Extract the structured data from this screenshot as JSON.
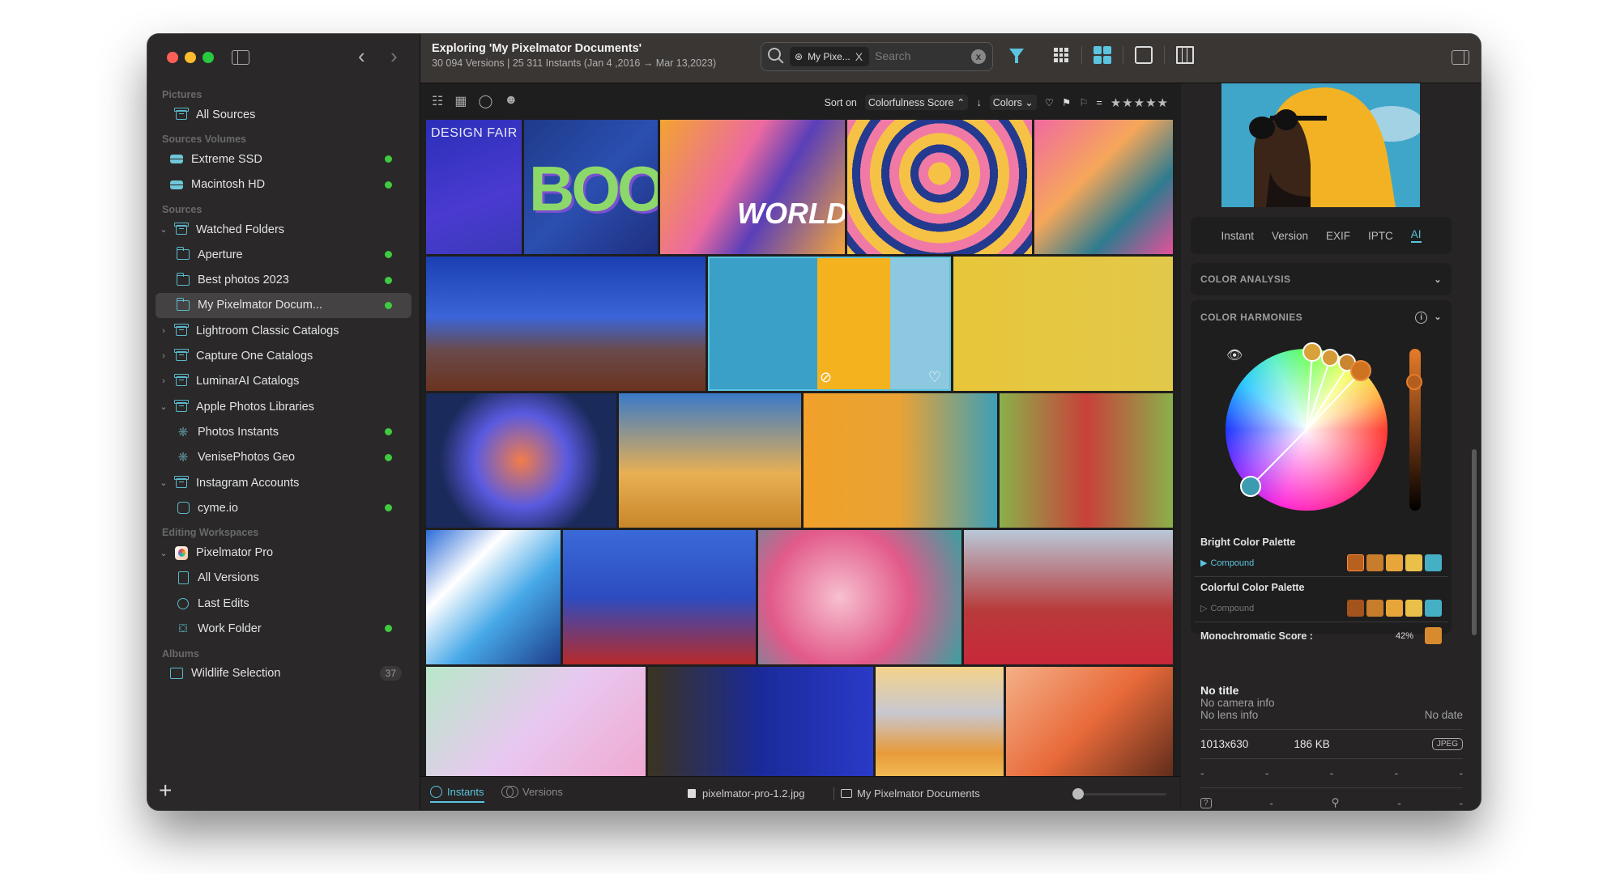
{
  "window": {
    "traffic_lights": [
      "close",
      "minimize",
      "zoom"
    ]
  },
  "sidebar": {
    "sections": [
      {
        "title": "Pictures",
        "items": [
          {
            "label": "All Sources",
            "icon": "archive-box-icon",
            "level": 0,
            "chevron": ""
          }
        ]
      },
      {
        "title": "Sources Volumes",
        "items": [
          {
            "label": "Extreme SSD",
            "icon": "drive-icon",
            "level": 1,
            "status": "online"
          },
          {
            "label": "Macintosh HD",
            "icon": "drive-icon",
            "level": 1,
            "status": "online"
          }
        ]
      },
      {
        "title": "Sources",
        "items": [
          {
            "label": "Watched Folders",
            "icon": "archive-box-icon",
            "level": 0,
            "chevron": "⌄"
          },
          {
            "label": "Aperture",
            "icon": "folder-icon",
            "level": 2,
            "status": "online"
          },
          {
            "label": "Best photos 2023",
            "icon": "folder-icon",
            "level": 2,
            "status": "online"
          },
          {
            "label": "My Pixelmator Docum...",
            "icon": "folder-icon",
            "level": 2,
            "status": "online",
            "selected": true
          },
          {
            "label": "Lightroom Classic Catalogs",
            "icon": "archive-box-icon",
            "level": 0,
            "chevron": "›"
          },
          {
            "label": "Capture One Catalogs",
            "icon": "archive-box-icon",
            "level": 0,
            "chevron": "›"
          },
          {
            "label": "LuminarAI Catalogs",
            "icon": "archive-box-icon",
            "level": 0,
            "chevron": "›"
          },
          {
            "label": "Apple Photos Libraries",
            "icon": "archive-box-icon",
            "level": 0,
            "chevron": "⌄"
          },
          {
            "label": "Photos Instants",
            "icon": "photos-flower-icon",
            "level": 2,
            "status": "online"
          },
          {
            "label": "VenisePhotos Geo",
            "icon": "photos-flower-icon",
            "level": 2,
            "status": "online"
          },
          {
            "label": "Instagram Accounts",
            "icon": "archive-box-icon",
            "level": 0,
            "chevron": "⌄"
          },
          {
            "label": "cyme.io",
            "icon": "instagram-icon",
            "level": 2,
            "status": "online"
          }
        ]
      },
      {
        "title": "Editing Workspaces",
        "items": [
          {
            "label": "Pixelmator Pro",
            "icon": "pixelmator-app-icon",
            "level": 0,
            "chevron": "⌄"
          },
          {
            "label": "All Versions",
            "icon": "document-icon",
            "level": 2
          },
          {
            "label": "Last Edits",
            "icon": "clock-icon",
            "level": 2
          },
          {
            "label": "Work Folder",
            "icon": "inbox-tray-icon",
            "level": 2,
            "status": "online"
          }
        ]
      },
      {
        "title": "Albums",
        "items": [
          {
            "label": "Wildlife Selection",
            "icon": "photo-album-icon",
            "level": 1,
            "count": "37"
          }
        ]
      }
    ],
    "add_label": "+"
  },
  "toolbar": {
    "title": "Exploring 'My Pixelmator Documents'",
    "subtitle": "30 094 Versions | 25 311 Instants (Jan 4 ,2016 → Mar 13,2023)",
    "search": {
      "token": "My Pixe...",
      "token_close": "X",
      "placeholder": "Search",
      "clear": "x"
    }
  },
  "sortbar": {
    "sort_label": "Sort on",
    "sort_value": "Colorfulness Score ⌃",
    "direction": "↓",
    "colors_label": "Colors ⌄",
    "equals": "=",
    "stars": "★★★★★"
  },
  "grid": {
    "tiles": [
      {
        "name": "design-fair-poster",
        "label": "DESIGN FAIR"
      },
      {
        "name": "boo-3d-text",
        "label": "BOO"
      },
      {
        "name": "wake-the-world-illustration",
        "label": "WORLD"
      },
      {
        "name": "swirl-hair-illustration",
        "label": ""
      },
      {
        "name": "abstract-shapes",
        "label": ""
      },
      {
        "name": "desert-night-sky",
        "label": ""
      },
      {
        "name": "man-yellow-hood",
        "label": ""
      },
      {
        "name": "woman-green-sunglasses",
        "label": ""
      },
      {
        "name": "3d-abstract-shape",
        "label": ""
      },
      {
        "name": "rock-arch",
        "label": ""
      },
      {
        "name": "woman-portrait-orange",
        "label": ""
      },
      {
        "name": "woman-red-green-bg",
        "label": ""
      },
      {
        "name": "blue-white-abstract",
        "label": ""
      },
      {
        "name": "woman-blue-sky",
        "label": ""
      },
      {
        "name": "pink-flowers",
        "label": ""
      },
      {
        "name": "woman-red-top",
        "label": ""
      },
      {
        "name": "pastel-gradient",
        "label": ""
      },
      {
        "name": "man-blue-yellow-light",
        "label": ""
      },
      {
        "name": "mountain-lake-illustration",
        "label": ""
      },
      {
        "name": "orange-woman-illustration",
        "label": ""
      }
    ]
  },
  "bottombar": {
    "tabs": [
      {
        "label": "Instants",
        "active": true
      },
      {
        "label": "Versions",
        "active": false
      }
    ],
    "file_name": "pixelmator-pro-1.2.jpg",
    "folder_name": "My Pixelmator Documents",
    "zoom_slider_value": 0
  },
  "rightpanel": {
    "tabs": [
      {
        "label": "Instant",
        "active": false
      },
      {
        "label": "Version",
        "active": false
      },
      {
        "label": "EXIF",
        "active": false
      },
      {
        "label": "IPTC",
        "active": false
      },
      {
        "label": "AI",
        "active": true
      }
    ],
    "color_analysis_title": "COLOR ANALYSIS",
    "color_harmonies_title": "COLOR HARMONIES",
    "info_icon": "i",
    "brightness_slider_value": 0.83,
    "bright_palette": {
      "title": "Bright Color Palette",
      "harmony": "Compound",
      "colors": [
        "#b8611f",
        "#c77d2b",
        "#e8a53a",
        "#e9c14a",
        "#45afc6"
      ]
    },
    "colorful_palette": {
      "title": "Colorful Color Palette",
      "harmony": "Compound",
      "colors": [
        "#a5531c",
        "#c77d2b",
        "#e8a53a",
        "#e9c14a",
        "#45afc6"
      ]
    },
    "monochromatic": {
      "label": "Monochromatic Score :",
      "value": "42%",
      "color": "#d88b2e"
    },
    "meta": {
      "title": "No title",
      "camera": "No camera info",
      "lens": "No lens info",
      "date": "No date",
      "dimensions": "1013x630",
      "size": "186 KB",
      "format": "JPEG",
      "row3": [
        "-",
        "-",
        "-",
        "-",
        "-"
      ],
      "row4": [
        "-",
        "-",
        "-"
      ]
    }
  },
  "colors": {
    "accent": "#5bc4de",
    "online": "#3fca3f",
    "sidebar_bg": "#2a2828",
    "toolbar_bg": "#3a3634"
  }
}
